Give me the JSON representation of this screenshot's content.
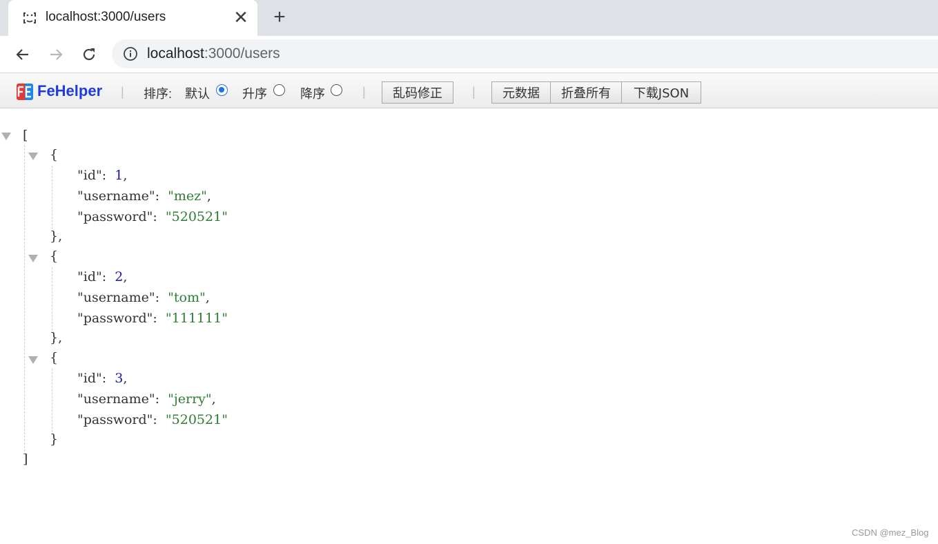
{
  "browser": {
    "tab_title": "localhost:3000/users",
    "tab_close": "✕",
    "new_tab": "+",
    "url_host": "localhost",
    "url_path": ":3000/users"
  },
  "fehelper": {
    "name": "FeHelper",
    "sort_label": "排序:",
    "sort_default": "默认",
    "sort_asc": "升序",
    "sort_desc": "降序",
    "sort_selected": "默认",
    "fix_encoding_button": "乱码修正",
    "metadata_button": "元数据",
    "collapse_all_button": "折叠所有",
    "download_json_button": "下载JSON"
  },
  "json_viewer": {
    "open_bracket": "[",
    "close_bracket": "]",
    "records": [
      {
        "id": "1",
        "username": "\"mez\"",
        "password": "\"520521\""
      },
      {
        "id": "2",
        "username": "\"tom\"",
        "password": "\"111111\""
      },
      {
        "id": "3",
        "username": "\"jerry\"",
        "password": "\"520521\""
      }
    ],
    "keys": {
      "id": "\"id\":",
      "username": "\"username\":",
      "password": "\"password\":"
    }
  },
  "watermark": "CSDN @mez_Blog",
  "colors": {
    "accent": "#1a73e8",
    "fehelper_brand": "#1f3bdb",
    "number": "#1a1aa6",
    "string": "#2e7d32"
  }
}
